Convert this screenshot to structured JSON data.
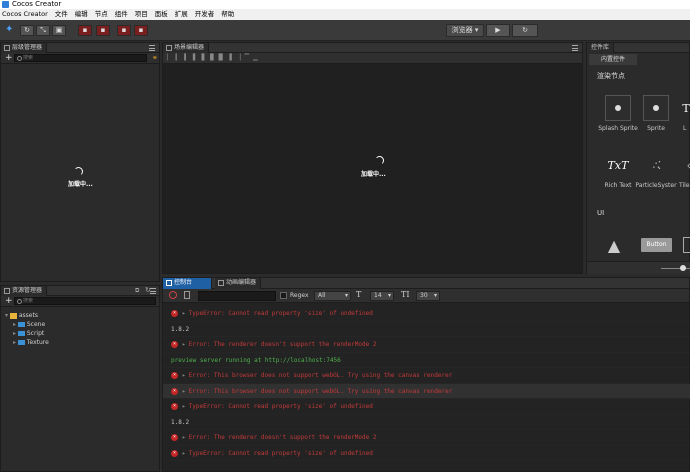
{
  "window": {
    "title": "Cocos Creator"
  },
  "menu": [
    "Cocos Creator",
    "文件",
    "编辑",
    "节点",
    "组件",
    "项目",
    "面板",
    "扩展",
    "开发者",
    "帮助"
  ],
  "toolbar": {
    "browser_label": "浏览器",
    "play_icon": "play-icon",
    "refresh_icon": "refresh-icon"
  },
  "hierarchy": {
    "tab": "层级管理器",
    "search_placeholder": "搜索",
    "loading": "加载中..."
  },
  "scene": {
    "tab": "场景编辑器",
    "loading": "加载中..."
  },
  "assets": {
    "tab": "资源管理器",
    "search_placeholder": "搜索",
    "root": "assets",
    "folders": [
      "Scene",
      "Script",
      "Texture"
    ]
  },
  "library": {
    "tab": "控件库",
    "subtab": "内置控件",
    "section_nodes": "渲染节点",
    "section_ui": "UI",
    "widgets_row1": [
      "Splash Sprite",
      "Sprite",
      "L"
    ],
    "widgets_row2": [
      "Rich Text",
      "ParticleSyster",
      "Tile"
    ],
    "button_label": "Button",
    "txt_label": "TxT"
  },
  "console": {
    "tab": "控制台",
    "anim_tab": "动画编辑器",
    "regex_label": "Regex",
    "filter": "All",
    "font_size": "14",
    "line_height": "30",
    "lines": [
      {
        "type": "err",
        "text": "TypeError: Cannot read property 'size' of undefined"
      },
      {
        "type": "info",
        "text": "1.8.2"
      },
      {
        "type": "err",
        "text": "Error: The renderer doesn't support the renderMode 2"
      },
      {
        "type": "ok",
        "text": "preview server running at http://localhost:7456"
      },
      {
        "type": "err",
        "text": "Error: This browser does not support webGL. Try using the canvas renderer"
      },
      {
        "type": "err",
        "text": "Error: This browser does not support webGL. Try using the canvas renderer"
      },
      {
        "type": "err",
        "text": "TypeError: Cannot read property 'size' of undefined"
      },
      {
        "type": "info",
        "text": "1.8.2"
      },
      {
        "type": "err",
        "text": "Error: The renderer doesn't support the renderMode 2"
      },
      {
        "type": "err",
        "text": "TypeError: Cannot read property 'size' of undefined"
      }
    ]
  }
}
